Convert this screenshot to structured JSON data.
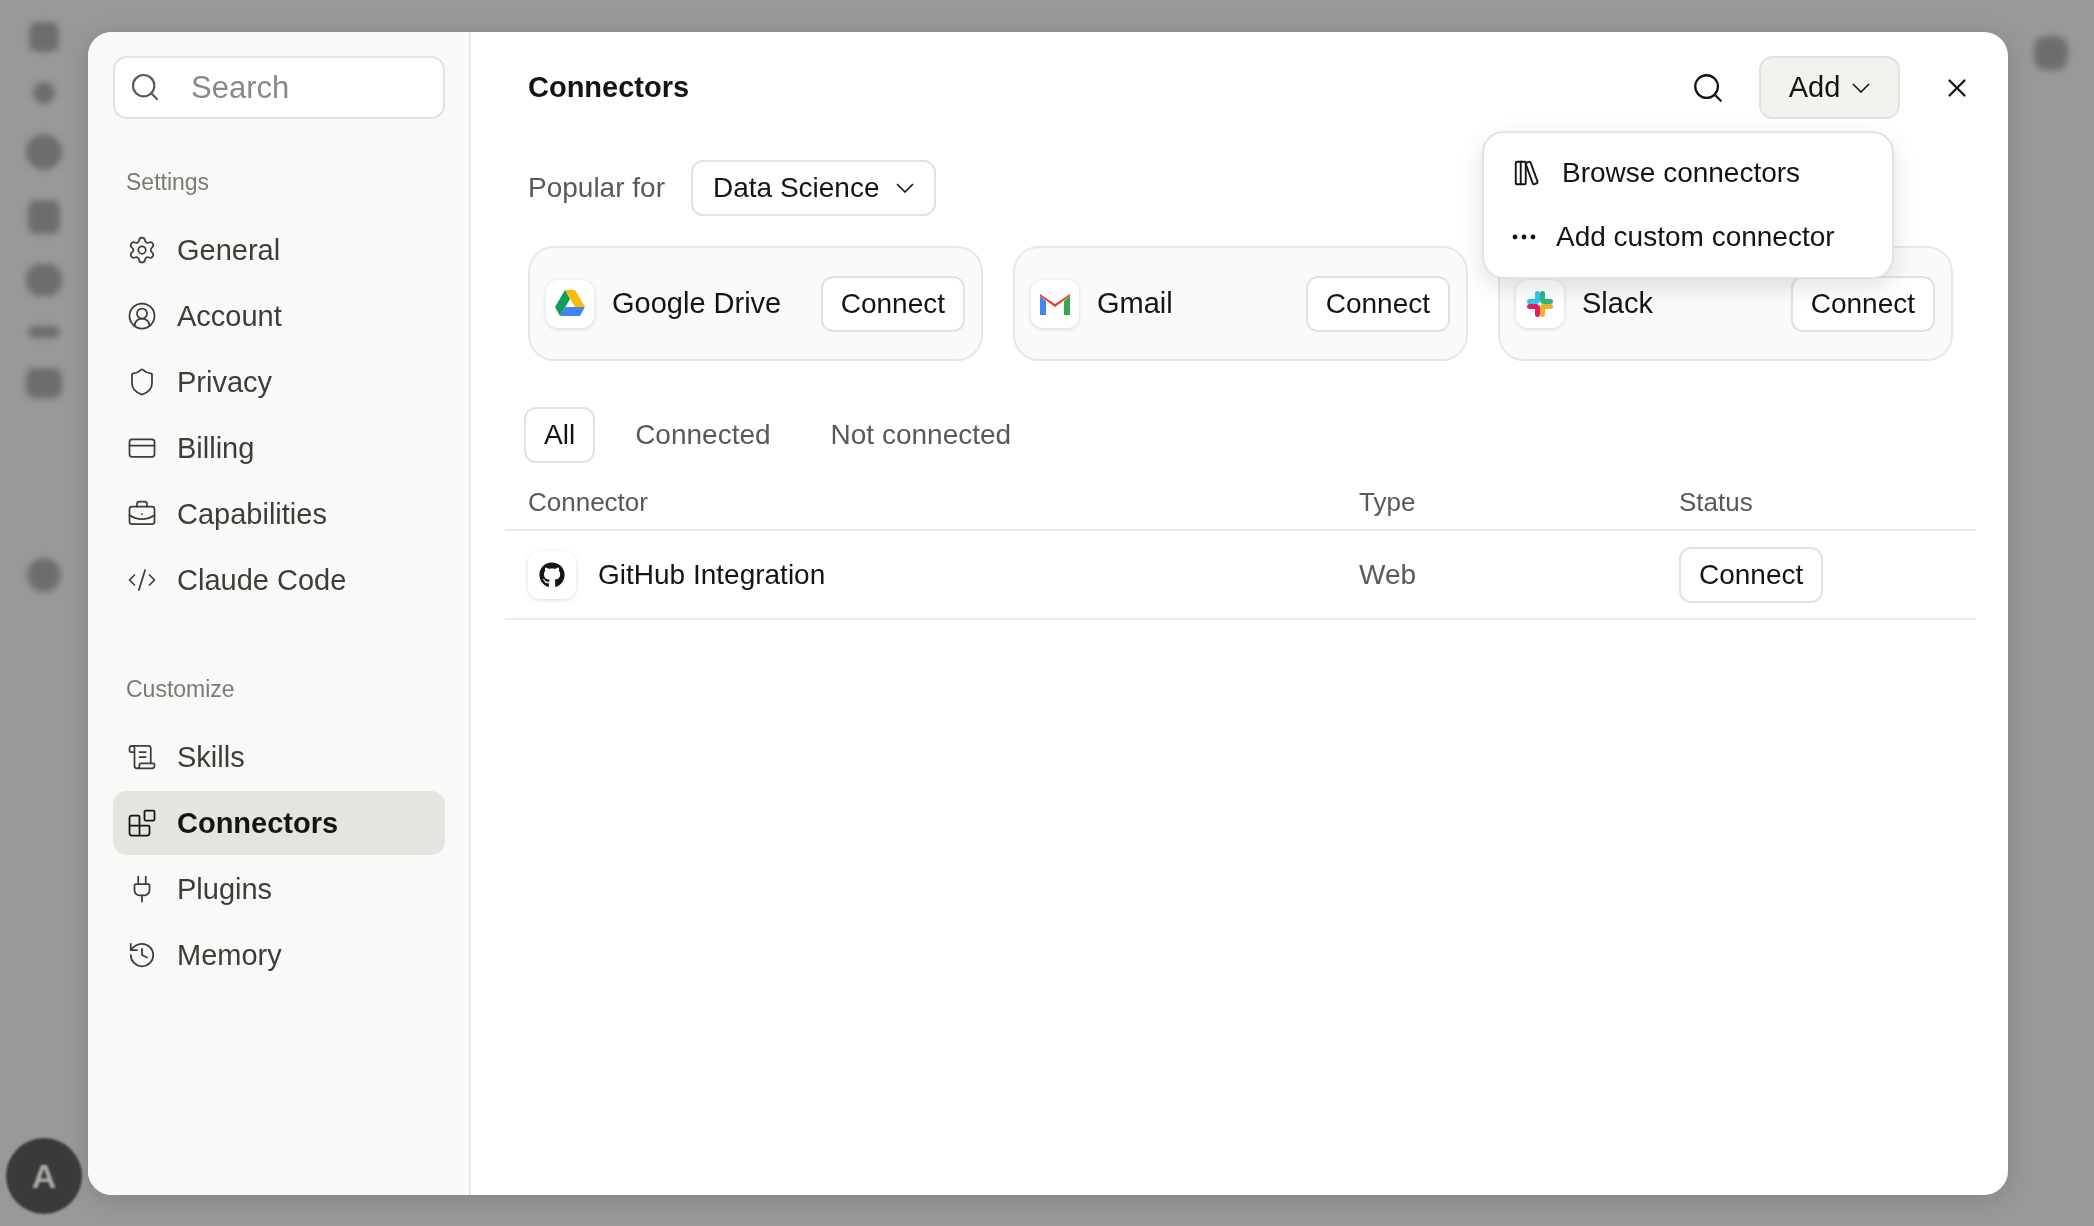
{
  "background": {
    "avatar": "A"
  },
  "sidebar": {
    "search": {
      "placeholder": "Search"
    },
    "sections": [
      {
        "title": "Settings",
        "items": [
          {
            "label": "General",
            "selected": false
          },
          {
            "label": "Account",
            "selected": false
          },
          {
            "label": "Privacy",
            "selected": false
          },
          {
            "label": "Billing",
            "selected": false
          },
          {
            "label": "Capabilities",
            "selected": false
          },
          {
            "label": "Claude Code",
            "selected": false
          }
        ]
      },
      {
        "title": "Customize",
        "items": [
          {
            "label": "Skills",
            "selected": false
          },
          {
            "label": "Connectors",
            "selected": true
          },
          {
            "label": "Plugins",
            "selected": false
          },
          {
            "label": "Memory",
            "selected": false
          }
        ]
      }
    ]
  },
  "main": {
    "title": "Connectors",
    "add_button": "Add",
    "menu": {
      "items": [
        {
          "label": "Browse connectors"
        },
        {
          "label": "Add custom connector"
        }
      ]
    },
    "popular": {
      "label": "Popular for",
      "value": "Data Science"
    },
    "cards": [
      {
        "name": "Google Drive",
        "action": "Connect"
      },
      {
        "name": "Gmail",
        "action": "Connect"
      },
      {
        "name": "Slack",
        "action": "Connect"
      }
    ],
    "filters": [
      {
        "label": "All",
        "selected": true
      },
      {
        "label": "Connected",
        "selected": false
      },
      {
        "label": "Not connected",
        "selected": false
      }
    ],
    "table": {
      "columns": [
        "Connector",
        "Type",
        "Status"
      ],
      "rows": [
        {
          "name": "GitHub Integration",
          "type": "Web",
          "action": "Connect"
        }
      ]
    }
  }
}
